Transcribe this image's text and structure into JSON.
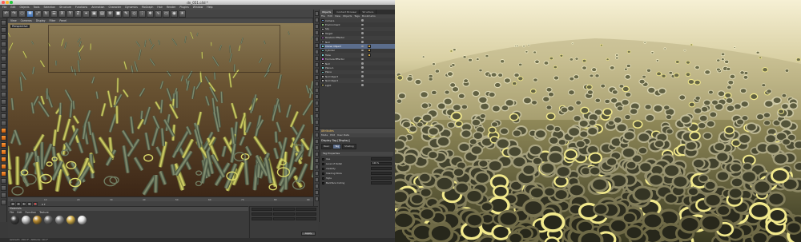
{
  "window": {
    "title": "dn_051.c4d *"
  },
  "menu": {
    "items": [
      "File",
      "Edit",
      "Objects",
      "Tools",
      "Selection",
      "Structure",
      "Functions",
      "Animation",
      "Character",
      "Dynamics",
      "MoGraph",
      "Hair",
      "Render",
      "Plugins",
      "Window",
      "Help"
    ]
  },
  "toolbar": {
    "icons": [
      "undo-icon",
      "redo-icon",
      "live-select-icon",
      "move-icon",
      "scale-icon",
      "rotate-icon",
      "recent-icon",
      "x-axis-icon",
      "y-axis-icon",
      "z-axis-icon",
      "coord-system-icon",
      "render-view-icon",
      "render-picture-viewer-icon",
      "edit-render-settings-icon",
      "cube-icon",
      "pen-icon",
      "subdivision-icon",
      "array-icon",
      "cloner-icon",
      "deformer-icon",
      "floor-icon",
      "camera-icon",
      "light-icon"
    ]
  },
  "viewport": {
    "menu": [
      "View",
      "Cameras",
      "Display",
      "Filter",
      "Panel"
    ],
    "label": "Perspective"
  },
  "timeline": {
    "ticks": [
      "0",
      "10",
      "20",
      "30",
      "40",
      "50",
      "60",
      "70",
      "80",
      "90"
    ],
    "current_frame": "0 F"
  },
  "materials": {
    "title": "Materials",
    "menu": [
      "File",
      "Edit",
      "Function",
      "Texture"
    ],
    "swatch_colors": [
      "#3c3c3c",
      "#c9c9c9",
      "#b98a2e",
      "#6e6e6e",
      "#8a8a8a",
      "#d4b04a",
      "#e6e6e6"
    ]
  },
  "coordinates": {
    "apply_label": "Apply"
  },
  "objects": {
    "tabs": [
      "Objects",
      "Content Browser",
      "Structure"
    ],
    "menu": [
      "File",
      "Edit",
      "View",
      "Objects",
      "Tags",
      "Bookmarks"
    ],
    "rows": [
      {
        "name": "Camera",
        "color": "#6fa0d8"
      },
      {
        "name": "Environment",
        "color": "#8fc07a"
      },
      {
        "name": "Sky",
        "color": "#d8d8d8"
      },
      {
        "name": "Target",
        "color": "#b0b0b0"
      },
      {
        "name": "Random Effector",
        "color": "#c76ddd"
      },
      {
        "name": "Null",
        "color": "#b0b0b0"
      },
      {
        "name": "Cloner Object",
        "color": "#7ad0d0"
      },
      {
        "name": "Cylinder",
        "color": "#7ad0d0"
      },
      {
        "name": "Tube",
        "color": "#7ad0d0"
      },
      {
        "name": "Formula Effector",
        "color": "#c76ddd"
      },
      {
        "name": "Null",
        "color": "#b0b0b0"
      },
      {
        "name": "Plane.1",
        "color": "#7ad0d0"
      },
      {
        "name": "Plane",
        "color": "#7ad0d0"
      },
      {
        "name": "Null Object",
        "color": "#b0b0b0"
      },
      {
        "name": "Null Object",
        "color": "#b0b0b0"
      },
      {
        "name": "Light",
        "color": "#f0e080"
      }
    ]
  },
  "attributes": {
    "header": "Attributes",
    "tabs": [
      "Mode",
      "Edit",
      "User Data"
    ],
    "object_title": "Display Tag [Display]",
    "modes": [
      "Basic",
      "Tag",
      "Shading"
    ],
    "section": "Tag Properties",
    "params": [
      {
        "label": "Use",
        "value": ""
      },
      {
        "label": "Level of Detail",
        "value": "100 %"
      },
      {
        "label": "Visibility",
        "value": ""
      },
      {
        "label": "Shading Mode",
        "value": ""
      },
      {
        "label": "Style",
        "value": ""
      },
      {
        "label": "Backface Culling",
        "value": ""
      }
    ]
  },
  "status": {
    "text": "Azimuth: 150.3°, Altitude: 10.1°"
  }
}
